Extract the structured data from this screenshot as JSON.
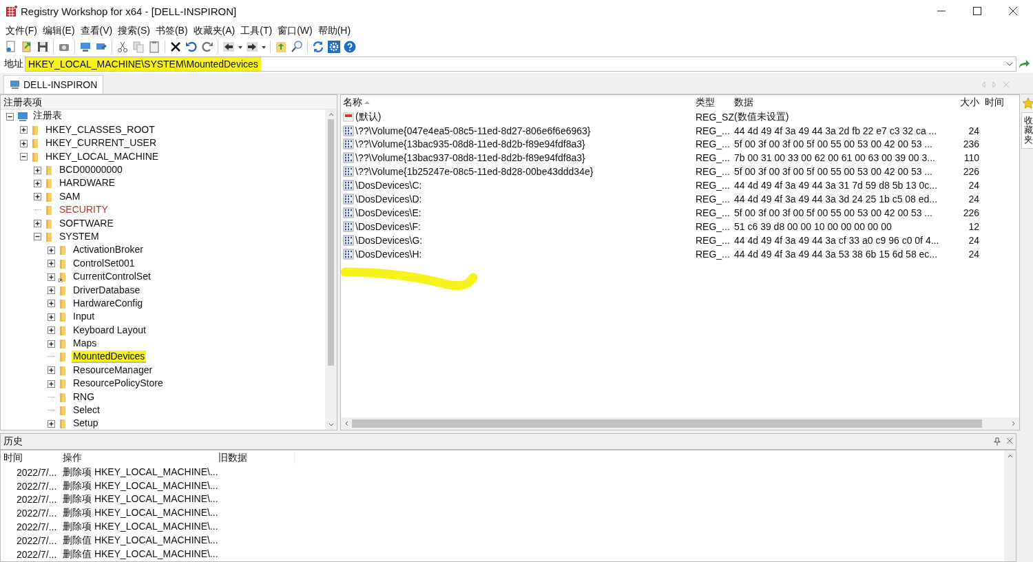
{
  "window": {
    "title": "Registry Workshop for x64 - [DELL-INSPIRON]"
  },
  "menu": [
    "文件(F)",
    "编辑(E)",
    "查看(V)",
    "搜索(S)",
    "书签(B)",
    "收藏夹(A)",
    "工具(T)",
    "窗口(W)",
    "帮助(H)"
  ],
  "address": {
    "label": "地址",
    "value": "HKEY_LOCAL_MACHINE\\SYSTEM\\MountedDevices",
    "highlighted": true
  },
  "document_tabs": [
    {
      "label": "DELL-INSPIRON",
      "selected": true
    }
  ],
  "side_tab": {
    "label": "收藏夹"
  },
  "tree": {
    "header": "注册表项",
    "nodes": [
      {
        "label": "注册表",
        "kind": "computer",
        "has_children": true,
        "expanded": true,
        "selected": false,
        "highlighted": false,
        "restricted": false,
        "children": [
          {
            "label": "HKEY_CLASSES_ROOT",
            "kind": "folder",
            "has_children": true,
            "expanded": false,
            "selected": false,
            "highlighted": false,
            "restricted": false,
            "link": false
          },
          {
            "label": "HKEY_CURRENT_USER",
            "kind": "folder",
            "has_children": true,
            "expanded": false,
            "selected": false,
            "highlighted": false,
            "restricted": false,
            "link": false
          },
          {
            "label": "HKEY_LOCAL_MACHINE",
            "kind": "folder",
            "has_children": true,
            "expanded": true,
            "selected": false,
            "highlighted": false,
            "restricted": false,
            "link": false,
            "children": [
              {
                "label": "BCD00000000",
                "kind": "folder",
                "has_children": true,
                "expanded": false,
                "selected": false,
                "highlighted": false,
                "restricted": false,
                "link": false
              },
              {
                "label": "HARDWARE",
                "kind": "folder",
                "has_children": true,
                "expanded": false,
                "selected": false,
                "highlighted": false,
                "restricted": false,
                "link": false
              },
              {
                "label": "SAM",
                "kind": "folder",
                "has_children": true,
                "expanded": false,
                "selected": false,
                "highlighted": false,
                "restricted": false,
                "link": false
              },
              {
                "label": "SECURITY",
                "kind": "folder",
                "has_children": false,
                "selected": false,
                "highlighted": false,
                "restricted": true,
                "link": false
              },
              {
                "label": "SOFTWARE",
                "kind": "folder",
                "has_children": true,
                "expanded": false,
                "selected": false,
                "highlighted": false,
                "restricted": false,
                "link": false
              },
              {
                "label": "SYSTEM",
                "kind": "folder",
                "has_children": true,
                "expanded": true,
                "selected": false,
                "highlighted": false,
                "restricted": false,
                "link": false,
                "children": [
                  {
                    "label": "ActivationBroker",
                    "kind": "folder",
                    "has_children": true,
                    "expanded": false,
                    "selected": false,
                    "highlighted": false,
                    "restricted": false,
                    "link": false
                  },
                  {
                    "label": "ControlSet001",
                    "kind": "folder",
                    "has_children": true,
                    "expanded": false,
                    "selected": false,
                    "highlighted": false,
                    "restricted": false,
                    "link": false
                  },
                  {
                    "label": "CurrentControlSet",
                    "kind": "folder",
                    "has_children": true,
                    "expanded": false,
                    "selected": false,
                    "highlighted": false,
                    "restricted": false,
                    "link": true
                  },
                  {
                    "label": "DriverDatabase",
                    "kind": "folder",
                    "has_children": true,
                    "expanded": false,
                    "selected": false,
                    "highlighted": false,
                    "restricted": false,
                    "link": false
                  },
                  {
                    "label": "HardwareConfig",
                    "kind": "folder",
                    "has_children": true,
                    "expanded": false,
                    "selected": false,
                    "highlighted": false,
                    "restricted": false,
                    "link": false
                  },
                  {
                    "label": "Input",
                    "kind": "folder",
                    "has_children": true,
                    "expanded": false,
                    "selected": false,
                    "highlighted": false,
                    "restricted": false,
                    "link": false
                  },
                  {
                    "label": "Keyboard Layout",
                    "kind": "folder",
                    "has_children": true,
                    "expanded": false,
                    "selected": false,
                    "highlighted": false,
                    "restricted": false,
                    "link": false
                  },
                  {
                    "label": "Maps",
                    "kind": "folder",
                    "has_children": true,
                    "expanded": false,
                    "selected": false,
                    "highlighted": false,
                    "restricted": false,
                    "link": false
                  },
                  {
                    "label": "MountedDevices",
                    "kind": "folder",
                    "has_children": false,
                    "selected": true,
                    "highlighted": true,
                    "restricted": false,
                    "link": false
                  },
                  {
                    "label": "ResourceManager",
                    "kind": "folder",
                    "has_children": true,
                    "expanded": false,
                    "selected": false,
                    "highlighted": false,
                    "restricted": false,
                    "link": false
                  },
                  {
                    "label": "ResourcePolicyStore",
                    "kind": "folder",
                    "has_children": true,
                    "expanded": false,
                    "selected": false,
                    "highlighted": false,
                    "restricted": false,
                    "link": false
                  },
                  {
                    "label": "RNG",
                    "kind": "folder",
                    "has_children": false,
                    "selected": false,
                    "highlighted": false,
                    "restricted": false,
                    "link": false
                  },
                  {
                    "label": "Select",
                    "kind": "folder",
                    "has_children": false,
                    "selected": false,
                    "highlighted": false,
                    "restricted": false,
                    "link": false
                  },
                  {
                    "label": "Setup",
                    "kind": "folder",
                    "has_children": true,
                    "expanded": false,
                    "selected": false,
                    "highlighted": false,
                    "restricted": false,
                    "link": false
                  }
                ]
              }
            ]
          }
        ]
      }
    ]
  },
  "values": {
    "columns": [
      "名称",
      "类型",
      "数据",
      "大小",
      "时间"
    ],
    "rows": [
      {
        "kind": "string",
        "name": "(默认)",
        "type": "REG_SZ",
        "data": "(数值未设置)",
        "size": ""
      },
      {
        "kind": "binary",
        "name": "\\??\\Volume{047e4ea5-08c5-11ed-8d27-806e6f6e6963}",
        "type": "REG_...",
        "data": "44 4d 49 4f 3a 49 44 3a 2d fb 22 e7 c3 32 ca ...",
        "size": "24"
      },
      {
        "kind": "binary",
        "name": "\\??\\Volume{13bac935-08d8-11ed-8d2b-f89e94fdf8a3}",
        "type": "REG_...",
        "data": "5f 00 3f 00 3f 00 5f 00 55 00 53 00 42 00 53 ...",
        "size": "236"
      },
      {
        "kind": "binary",
        "name": "\\??\\Volume{13bac937-08d8-11ed-8d2b-f89e94fdf8a3}",
        "type": "REG_...",
        "data": "7b 00 31 00 33 00 62 00 61 00 63 00 39 00 3...",
        "size": "110"
      },
      {
        "kind": "binary",
        "name": "\\??\\Volume{1b25247e-08c5-11ed-8d28-00be43ddd34e}",
        "type": "REG_...",
        "data": "5f 00 3f 00 3f 00 5f 00 55 00 53 00 42 00 53 ...",
        "size": "226"
      },
      {
        "kind": "binary",
        "name": "\\DosDevices\\C:",
        "type": "REG_...",
        "data": "44 4d 49 4f 3a 49 44 3a 31 7d 59 d8 5b 13 0c...",
        "size": "24"
      },
      {
        "kind": "binary",
        "name": "\\DosDevices\\D:",
        "type": "REG_...",
        "data": "44 4d 49 4f 3a 49 44 3a 3d 24 25 1b c5 08 ed...",
        "size": "24"
      },
      {
        "kind": "binary",
        "name": "\\DosDevices\\E:",
        "type": "REG_...",
        "data": "5f 00 3f 00 3f 00 5f 00 55 00 53 00 42 00 53 ...",
        "size": "226"
      },
      {
        "kind": "binary",
        "name": "\\DosDevices\\F:",
        "type": "REG_...",
        "data": "51 c6 39 d8 00 00 10 00 00 00 00 00",
        "size": "12"
      },
      {
        "kind": "binary",
        "name": "\\DosDevices\\G:",
        "type": "REG_...",
        "data": "44 4d 49 4f 3a 49 44 3a cf 33 a0 c9 96 c0 0f 4...",
        "size": "24"
      },
      {
        "kind": "binary",
        "name": "\\DosDevices\\H:",
        "type": "REG_...",
        "data": "44 4d 49 4f 3a 49 44 3a 53 38 6b 15 6d 58 ec...",
        "size": "24"
      }
    ]
  },
  "history": {
    "title": "历史",
    "columns": [
      "时间",
      "操作",
      "旧数据"
    ],
    "rows": [
      {
        "time": "2022/7/...",
        "operation": "删除项 HKEY_LOCAL_MACHINE\\..."
      },
      {
        "time": "2022/7/...",
        "operation": "删除项 HKEY_LOCAL_MACHINE\\..."
      },
      {
        "time": "2022/7/...",
        "operation": "删除项 HKEY_LOCAL_MACHINE\\..."
      },
      {
        "time": "2022/7/...",
        "operation": "删除项 HKEY_LOCAL_MACHINE\\..."
      },
      {
        "time": "2022/7/...",
        "operation": "删除项 HKEY_LOCAL_MACHINE\\..."
      },
      {
        "time": "2022/7/...",
        "operation": "删除值 HKEY_LOCAL_MACHINE\\..."
      },
      {
        "time": "2022/7/...",
        "operation": "删除值 HKEY_LOCAL_MACHINE\\..."
      }
    ]
  }
}
